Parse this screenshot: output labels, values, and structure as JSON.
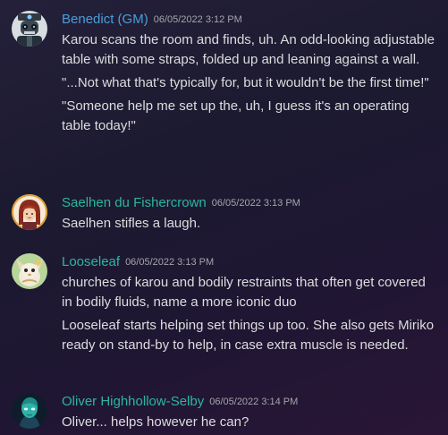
{
  "colors": {
    "gm_name": "#4a9ddb",
    "player_name": "#2bb6a2",
    "timestamp": "#a3a6aa",
    "text": "#dcddde"
  },
  "messages": [
    {
      "author": "Benedict (GM)",
      "timestamp": "06/05/2022 3:12 PM",
      "avatar_icon": "robot-skull-avatar-icon",
      "name_color": "#4a9ddb",
      "paragraphs": [
        "Karou scans the room and finds, uh. An odd-looking adjustable table with some straps, folded up and leaning against a wall.",
        "\"...Not what that's typically for, but it wouldn't be the first time!\"",
        "\"Someone help me set up the, uh, I guess it's an operating table today!\""
      ]
    },
    {
      "author": "Saelhen du Fishercrown",
      "timestamp": "06/05/2022 3:13 PM",
      "avatar_icon": "red-haired-girl-avatar-icon",
      "name_color": "#2bb6a2",
      "paragraphs": [
        "Saelhen stifles a laugh."
      ]
    },
    {
      "author": "Looseleaf",
      "timestamp": "06/05/2022 3:13 PM",
      "avatar_icon": "creature-avatar-icon",
      "name_color": "#2bb6a2",
      "paragraphs": [
        "churches of karou and bodily restraints that often get covered in bodily fluids, name a more iconic duo",
        "Looseleaf starts helping set things up too. She also gets Miriko ready on stand-by to help, in case extra muscle is needed."
      ]
    },
    {
      "author": "Oliver Highhollow-Selby",
      "timestamp": "06/05/2022 3:14 PM",
      "avatar_icon": "teal-spirit-avatar-icon",
      "name_color": "#2bb6a2",
      "paragraphs": [
        "Oliver... helps however he can?"
      ]
    }
  ]
}
